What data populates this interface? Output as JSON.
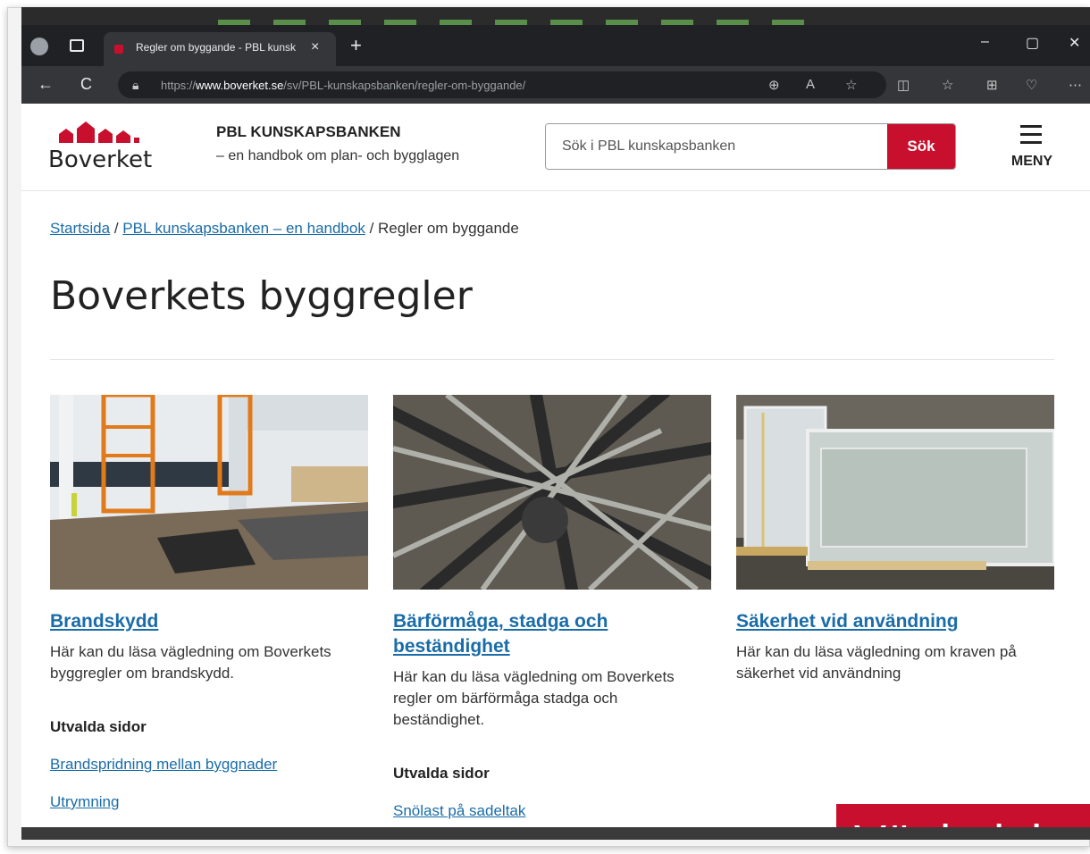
{
  "browser": {
    "tab_title": "Regler om byggande - PBL kunsk",
    "tab_close": "×",
    "new_tab": "+",
    "url_prefix": "https://",
    "url_domain": "www.boverket.se",
    "url_path": "/sv/PBL-kunskapsbanken/regler-om-byggande/",
    "back": "←",
    "reload": "C",
    "minimize": "–",
    "maximize": "▢",
    "close": "✕"
  },
  "header": {
    "logo_text": "Boverket",
    "title": "PBL KUNSKAPSBANKEN",
    "subtitle": "– en handbok om plan- och bygglagen",
    "search_placeholder": "Sök i PBL kunskapsbanken",
    "search_button": "Sök",
    "menu_label": "MENY"
  },
  "breadcrumb": {
    "home": "Startsida",
    "sep": " / ",
    "parent": "PBL kunskapsbanken – en handbok",
    "current": "Regler om byggande"
  },
  "page_title": "Boverkets byggregler",
  "cards": [
    {
      "title": "Brandskydd",
      "desc": "Här kan du läsa vägledning om Boverkets byggregler om brandskydd.",
      "featured_heading": "Utvalda sidor",
      "featured_links": [
        "Brandspridning mellan byggnader",
        "Utrymning"
      ]
    },
    {
      "title": "Bärförmåga, stadga och beständighet",
      "desc": "Här kan du läsa vägledning om Boverkets regler om bärförmåga stadga och beständighet.",
      "featured_heading": "Utvalda sidor",
      "featured_links": [
        "Snölast på sadeltak"
      ]
    },
    {
      "title": "Säkerhet vid användning",
      "desc": "Här kan du läsa vägledning om kraven på säkerhet vid användning"
    }
  ],
  "overlay_text": "Vägledning",
  "colors": {
    "brand_red": "#c8102e",
    "link_blue": "#1a6ca8"
  }
}
